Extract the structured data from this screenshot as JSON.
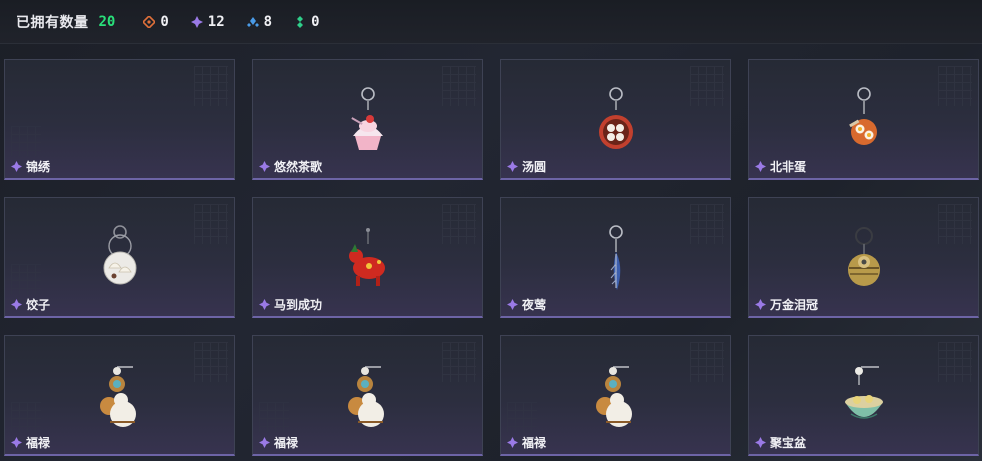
{
  "header": {
    "owned_label": "已拥有数量",
    "owned_count": "20",
    "stats": [
      {
        "icon": "orange-diamond-icon",
        "value": "0",
        "color": "#e0703a"
      },
      {
        "icon": "purple-diamond-icon",
        "value": "12",
        "color": "#9a7ae6"
      },
      {
        "icon": "blue-diamond-icon",
        "value": "8",
        "color": "#4a9be8"
      },
      {
        "icon": "green-diamond-icon",
        "value": "0",
        "color": "#2fcf8a"
      }
    ]
  },
  "items": [
    {
      "name": "锦绣",
      "art": "empty"
    },
    {
      "name": "悠然茶歌",
      "art": "cupcake-charm-icon"
    },
    {
      "name": "汤圆",
      "art": "tangyuan-bowl-charm-icon"
    },
    {
      "name": "北非蛋",
      "art": "shakshuka-charm-icon"
    },
    {
      "name": "饺子",
      "art": "dumpling-plate-charm-icon"
    },
    {
      "name": "马到成功",
      "art": "red-horse-charm-icon"
    },
    {
      "name": "夜莺",
      "art": "feather-charm-icon"
    },
    {
      "name": "万金泪冠",
      "art": "gold-ball-charm-icon"
    },
    {
      "name": "福禄",
      "art": "gourd-charm-icon"
    },
    {
      "name": "福禄",
      "art": "gourd-charm-icon"
    },
    {
      "name": "福禄",
      "art": "gourd-charm-icon"
    },
    {
      "name": "聚宝盆",
      "art": "treasure-bowl-charm-icon"
    }
  ],
  "colors": {
    "accent_green": "#29e07a",
    "rarity_purple": "#9a7ae6",
    "card_border_bottom": "#6d64a6"
  }
}
